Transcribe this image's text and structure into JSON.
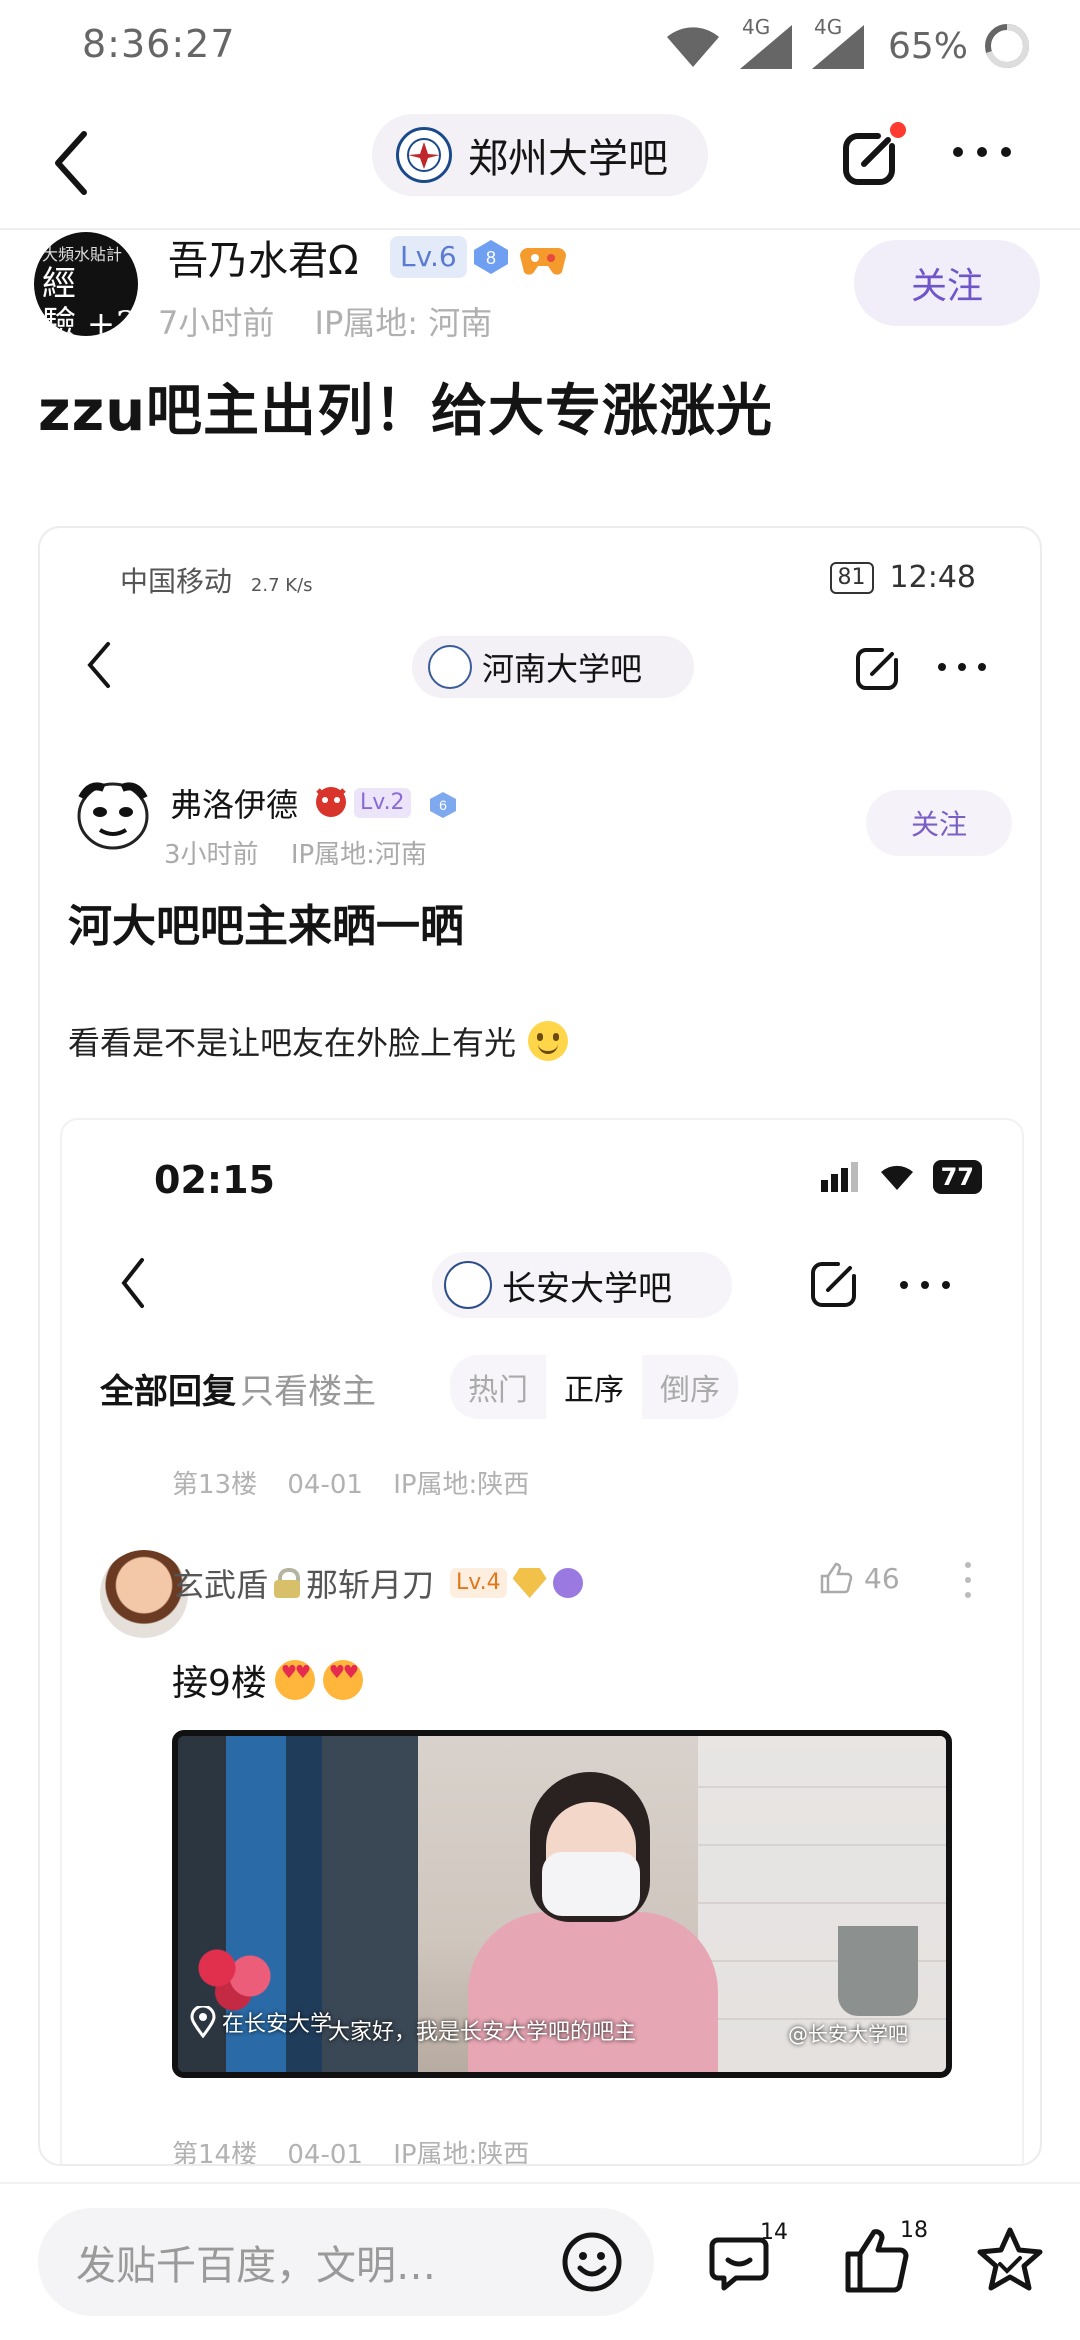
{
  "status_bar": {
    "time": "8:36:27",
    "signal1": "4G",
    "signal2": "4G",
    "battery": "65%"
  },
  "nav": {
    "forum_name": "郑州大学吧"
  },
  "post": {
    "author": "吾乃水君Ω",
    "level": "Lv.6",
    "badge_number": "8",
    "time_ago": "7小时前",
    "ip": "IP属地: 河南",
    "follow_label": "关注",
    "title": "zzu吧主出列！给大专涨涨光"
  },
  "avatar_text": {
    "line1": "經",
    "line2": "驗 +3",
    "small": "大頻水貼計"
  },
  "shot": {
    "status_left": "中国移动",
    "status_speed": "2.7 K/s",
    "battery": "81",
    "time": "12:48",
    "forum_name": "河南大学吧",
    "author": "弗洛伊德",
    "level": "Lv.2",
    "badge_number": "6",
    "time_ago": "3小时前",
    "ip": "IP属地:河南",
    "follow_label": "关注",
    "title": "河大吧吧主来晒一晒",
    "body": "看看是不是让吧友在外脸上有光"
  },
  "inner": {
    "time": "02:15",
    "battery": "77",
    "forum_name": "长安大学吧",
    "tab_all": "全部回复",
    "tab_owner": "只看楼主",
    "sort_hot": "热门",
    "sort_asc": "正序",
    "sort_desc": "倒序",
    "floor13": {
      "floor": "第13楼",
      "date": "04-01",
      "ip": "IP属地:陕西"
    },
    "reply_user_a": "玄武盾",
    "reply_user_b": "那斩月刀",
    "reply_level": "Lv.4",
    "reply_likes": "46",
    "reply_text": "接9楼",
    "video_location": "在长安大学",
    "video_caption": "大家好，我是长安大学吧的吧主",
    "video_watermark": "@长安大学吧",
    "floor14": {
      "floor": "第14楼",
      "date": "04-01",
      "ip": "IP属地:陕西"
    }
  },
  "bottom": {
    "input_placeholder": "发贴千百度，文明…",
    "comment_count": "14",
    "like_count": "18"
  },
  "colors": {
    "accent_purple": "#6e55c8",
    "follow_bg": "#f1eefa",
    "notify_red": "#ff3b30"
  }
}
